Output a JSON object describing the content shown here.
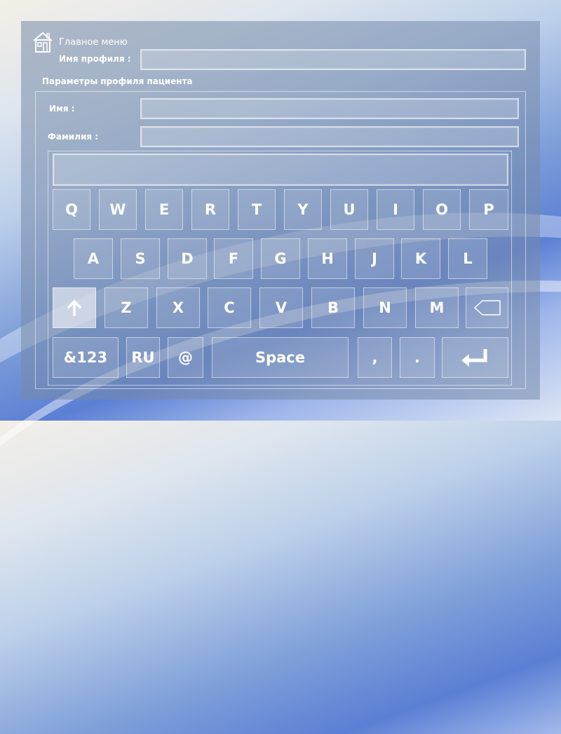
{
  "header": {
    "main_menu_label": "Главное меню",
    "home_icon": "home-icon"
  },
  "profile": {
    "name_label": "Имя профиля :",
    "name_value": ""
  },
  "patient_params": {
    "section_title": "Параметры профиля пациента",
    "first_name_label": "Имя :",
    "first_name_value": "",
    "last_name_label": "Фамилия :",
    "last_name_value": ""
  },
  "keyboard": {
    "display_value": "",
    "row1": [
      "Q",
      "W",
      "E",
      "R",
      "T",
      "Y",
      "U",
      "I",
      "O",
      "P"
    ],
    "row2": [
      "A",
      "S",
      "D",
      "F",
      "G",
      "H",
      "J",
      "K",
      "L"
    ],
    "row3": [
      "Z",
      "X",
      "C",
      "V",
      "B",
      "N",
      "M"
    ],
    "shift_icon": "arrow-up-icon",
    "backspace_icon": "backspace-icon",
    "numbers_label": "&123",
    "lang_label": "RU",
    "at_label": "@",
    "space_label": "Space",
    "comma_label": ",",
    "period_label": ".",
    "enter_icon": "enter-icon",
    "active_key_color": "#e5e9f0"
  }
}
